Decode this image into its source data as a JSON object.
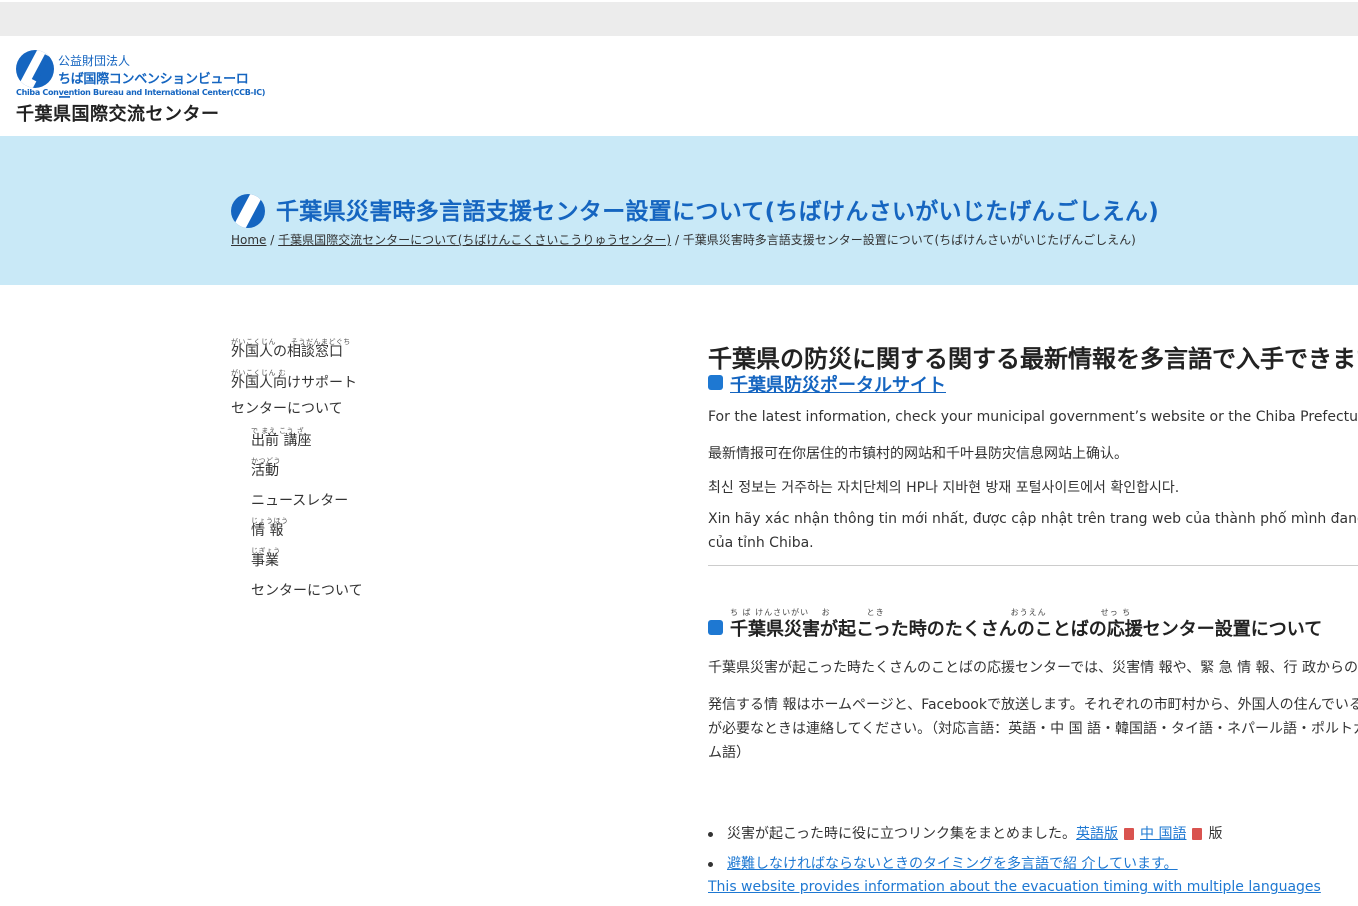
{
  "header": {
    "org_small": "公益財団法人",
    "org_name": "ちば国際コンベンションビューロー",
    "org_english": "Chiba Convention Bureau and International Center(CCB-IC)",
    "center_name": "千葉県国際交流センター"
  },
  "banner": {
    "title": "千葉県災害時多言語支援センター設置について(ちばけんさいがいじたげんごしえん)",
    "breadcrumb": {
      "home": "Home",
      "separator": " / ",
      "parent": "千葉県国際交流センターについて(ちばけんこくさいこうりゅうセンター)",
      "current": "千葉県災害時多言語支援センター設置について(ちばけんさいがいじたげんごしえん)"
    }
  },
  "sidebar": {
    "items": [
      {
        "label": "外国人の相談窓口",
        "ruby": "がいこくじん　　そうだんまどぐち"
      },
      {
        "label": "外国人向けサポート",
        "ruby": "がいこくじん む"
      },
      {
        "label": "センターについて",
        "ruby": ""
      }
    ],
    "subitems": [
      {
        "label": "出前 講座",
        "ruby": "で まえ こう ざ"
      },
      {
        "label": "活動",
        "ruby": "かつどう"
      },
      {
        "label": "ニュースレター",
        "ruby": ""
      },
      {
        "label": "情 報",
        "ruby": "じょうほう"
      },
      {
        "label": "事業",
        "ruby": "じぎょう"
      },
      {
        "label": "センターについて",
        "ruby": ""
      }
    ]
  },
  "main": {
    "heading": "千葉県の防災に関する関する最新情報を多言語で入手できます",
    "portal_link": "千葉県防災ポータルサイト",
    "paragraphs": [
      "For the latest information, check your municipal government’s website or the Chiba Prefecture Disaster Prevention Portal Site.",
      "最新情报可在你居住的市镇村的网站和千叶县防灾信息网站上确认。",
      "최신 정보는 거주하는 자치단체의 HP나 지바현 방재 포털사이트에서 확인합시다.",
      "Xin hãy xác nhận thông tin mới nhất, được cập nhật trên trang web của thành phố mình đang sống, hoặc",
      "của tỉnh Chiba."
    ],
    "section_title": "千葉県災害が起こった時のたくさんのことばの応援センター設置について",
    "section_ruby": "ち ば けんさいがい　 お　　　　とき　　　　　　　　　　　　　　おうえん　　　　　　せっ ち",
    "body_lines": [
      "千葉県災害が起こった時たくさんのことばの応援センターでは、災害情 報や、緊 急 情 報、行 政からの情報を",
      "発信する情 報はホームページと、Facebookで放送します。それぞれの市町村から、外国人の住んでいる",
      "が必要なときは連絡してください。（対応言語：英語・中 国 語・韓国語・タイ語・ネパール語・ポルトガル語",
      "ム語）"
    ],
    "list": [
      {
        "text": "災害が起こった時に役に立つリンク集をまとめました。",
        "link1": "英語版",
        "link2": "中 国語",
        "tail": "版"
      },
      {
        "text": "避難しなければならないときのタイミングを多言語で紹 介しています。"
      }
    ],
    "english_link": "This website provides information about the evacuation timing with multiple languages"
  }
}
